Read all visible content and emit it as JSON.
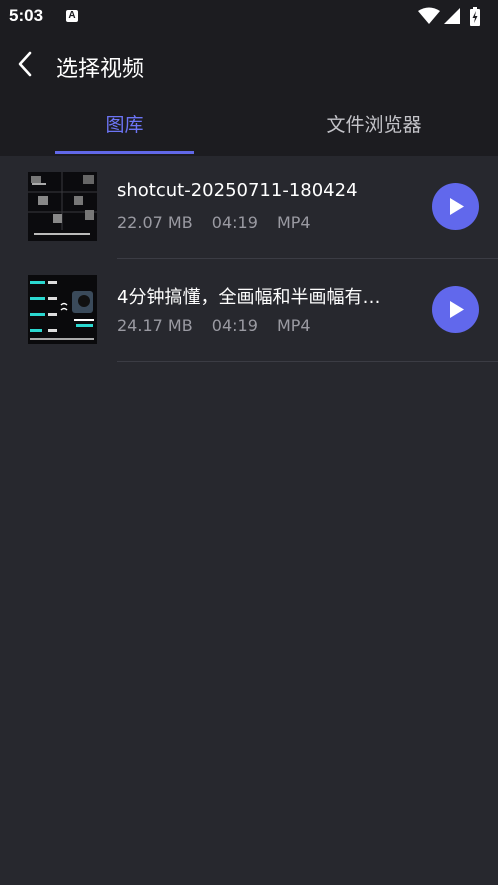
{
  "status_bar": {
    "time": "5:03",
    "notification_icon_letter": "A"
  },
  "header": {
    "title": "选择视频",
    "back_icon": "back-arrow-icon"
  },
  "tabs": [
    {
      "label": "图库",
      "selected": true
    },
    {
      "label": "文件浏览器",
      "selected": false
    }
  ],
  "videos": [
    {
      "title": "shotcut-20250711-180424",
      "size": "22.07 MB",
      "duration": "04:19",
      "format": "MP4"
    },
    {
      "title": "4分钟搞懂，全画幅和半画幅有…",
      "size": "24.17 MB",
      "duration": "04:19",
      "format": "MP4"
    }
  ],
  "colors": {
    "accent": "#6168ec",
    "tab_selected": "#6c74f4",
    "background": "#27282e",
    "header_bg": "#1c1c20"
  }
}
